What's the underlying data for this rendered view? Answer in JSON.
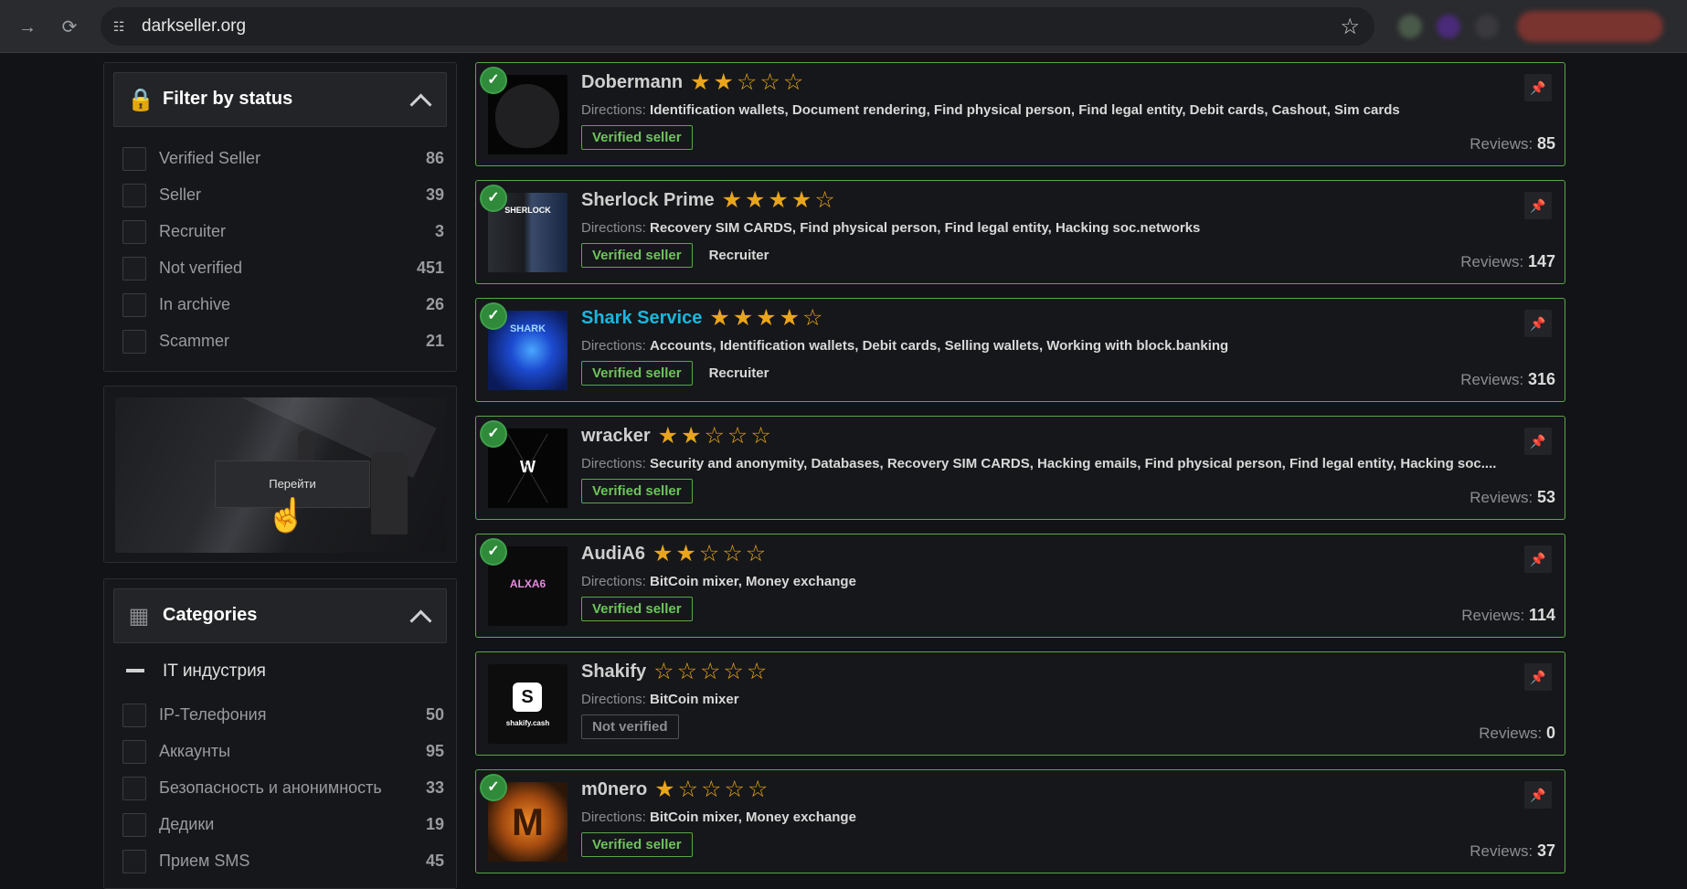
{
  "browser": {
    "url": "darkseller.org",
    "forward_icon": "arrow-right-icon",
    "reload_icon": "reload-icon",
    "site_info_icon": "tune-icon",
    "bookmark_icon": "star-outline-icon"
  },
  "filter": {
    "title": "Filter by status",
    "icon": "lock-icon",
    "items": [
      {
        "label": "Verified Seller",
        "count": "86"
      },
      {
        "label": "Seller",
        "count": "39"
      },
      {
        "label": "Recruiter",
        "count": "3"
      },
      {
        "label": "Not verified",
        "count": "451"
      },
      {
        "label": "In archive",
        "count": "26"
      },
      {
        "label": "Scammer",
        "count": "21"
      }
    ]
  },
  "ad": {
    "button_label": "Перейти"
  },
  "categories": {
    "title": "Categories",
    "icon": "dashboard-icon",
    "group_label": "IT индустрия",
    "items": [
      {
        "label": "IP-Телефония",
        "count": "50"
      },
      {
        "label": "Аккаунты",
        "count": "95"
      },
      {
        "label": "Безопасность и анонимность",
        "count": "33"
      },
      {
        "label": "Дедики",
        "count": "19"
      },
      {
        "label": "Прием SMS",
        "count": "45"
      }
    ]
  },
  "sellers": [
    {
      "name": "Dobermann",
      "rating": 2,
      "verified": true,
      "directions_label": "Directions:",
      "directions": "Identification wallets, Document rendering, Find physical person, Find legal entity, Debit cards, Cashout, Sim cards",
      "status": "Verified seller",
      "role": "",
      "reviews_label": "Reviews:",
      "reviews": "85"
    },
    {
      "name": "Sherlock Prime",
      "rating": 4,
      "verified": true,
      "avatar_text": "SHERLOCK",
      "directions_label": "Directions:",
      "directions": "Recovery SIM CARDS, Find physical person, Find legal entity, Hacking soc.networks",
      "status": "Verified seller",
      "role": "Recruiter",
      "reviews_label": "Reviews:",
      "reviews": "147"
    },
    {
      "name": "Shark Service",
      "rating": 4,
      "verified": true,
      "highlight": true,
      "avatar_text": "SHARK",
      "directions_label": "Directions:",
      "directions": "Accounts, Identification wallets, Debit cards, Selling wallets, Working with block.banking",
      "status": "Verified seller",
      "role": "Recruiter",
      "reviews_label": "Reviews:",
      "reviews": "316"
    },
    {
      "name": "wracker",
      "rating": 2,
      "verified": true,
      "avatar_text": "W",
      "directions_label": "Directions:",
      "directions": "Security and anonymity, Databases, Recovery SIM CARDS, Hacking emails, Find physical person, Find legal entity, Hacking soc....",
      "status": "Verified seller",
      "role": "",
      "reviews_label": "Reviews:",
      "reviews": "53"
    },
    {
      "name": "AudiA6",
      "rating": 2,
      "verified": true,
      "avatar_text": "ALXA6",
      "directions_label": "Directions:",
      "directions": "BitCoin mixer, Money exchange",
      "status": "Verified seller",
      "role": "",
      "reviews_label": "Reviews:",
      "reviews": "114"
    },
    {
      "name": "Shakify",
      "rating": 0,
      "verified": false,
      "avatar_text": "shakify.cash",
      "directions_label": "Directions:",
      "directions": "BitCoin mixer",
      "status": "Not verified",
      "role": "",
      "reviews_label": "Reviews:",
      "reviews": "0"
    },
    {
      "name": "m0nero",
      "rating": 1,
      "verified": true,
      "avatar_text": "M",
      "directions_label": "Directions:",
      "directions": "BitCoin mixer, Money exchange",
      "status": "Verified seller",
      "role": "",
      "reviews_label": "Reviews:",
      "reviews": "37"
    }
  ],
  "colors": {
    "accent_green": "#5aa64a",
    "star": "#e9a51b",
    "highlight_name": "#19b8e0"
  }
}
